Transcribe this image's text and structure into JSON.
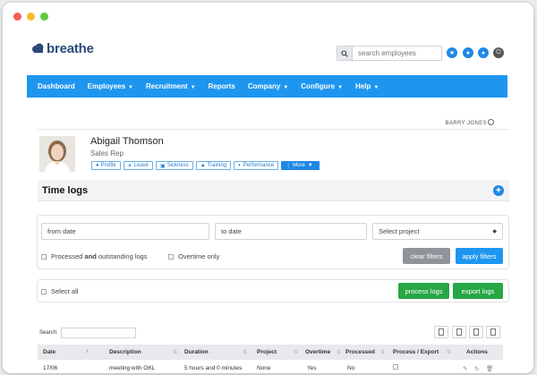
{
  "app": {
    "logo_text": "breathe"
  },
  "header": {
    "search_placeholder": "search employees",
    "icons": [
      "star-icon",
      "chat-icon",
      "user-icon",
      "power-icon"
    ]
  },
  "nav": {
    "items": [
      {
        "label": "Dashboard",
        "dropdown": false
      },
      {
        "label": "Employees",
        "dropdown": true
      },
      {
        "label": "Recruitment",
        "dropdown": true
      },
      {
        "label": "Reports",
        "dropdown": false
      },
      {
        "label": "Company",
        "dropdown": true
      },
      {
        "label": "Configure",
        "dropdown": true
      },
      {
        "label": "Help",
        "dropdown": true
      }
    ]
  },
  "current_user": "BARRY JONES",
  "profile": {
    "name": "Abigail Thomson",
    "role": "Sales Rep",
    "tabs": [
      {
        "label": "Profile",
        "icon": "person-icon"
      },
      {
        "label": "Leave",
        "icon": "plane-icon"
      },
      {
        "label": "Sickness",
        "icon": "medkit-icon"
      },
      {
        "label": "Training",
        "icon": "graduation-cap-icon"
      },
      {
        "label": "Performance",
        "icon": "gauge-icon"
      },
      {
        "label": "More",
        "icon": "ellipsis-icon"
      }
    ]
  },
  "section": {
    "title": "Time logs",
    "add_icon": "plus-icon"
  },
  "filters": {
    "from_date_placeholder": "from date",
    "to_date_placeholder": "to date",
    "project_select_value": "Select project",
    "processed_label_pre": "Processed ",
    "processed_label_bold": "and",
    "processed_label_post": " outstanding logs",
    "overtime_label": "Overtime only",
    "clear_label": "clear filters",
    "apply_label": "apply filters"
  },
  "bulk": {
    "select_all_label": "Select all",
    "process_label": "process logs",
    "export_label": "export logs"
  },
  "table": {
    "search_label": "Search:",
    "export_icons": [
      "copy-icon",
      "excel-icon",
      "csv-icon",
      "pdf-icon"
    ],
    "columns": [
      "Date",
      "Description",
      "Duration",
      "Project",
      "Overtime",
      "Processed",
      "Process / Export",
      "Actions"
    ],
    "rows": [
      {
        "date": "17/06",
        "description": "meeting with OKL",
        "duration": "5 hours and 0 minutes",
        "project": "None",
        "overtime": "Yes",
        "processed": "No"
      }
    ]
  },
  "colors": {
    "nav_blue": "#1e96f0",
    "brand_navy": "#2b4a7a",
    "green": "#27a745",
    "grey": "#8e9499"
  }
}
